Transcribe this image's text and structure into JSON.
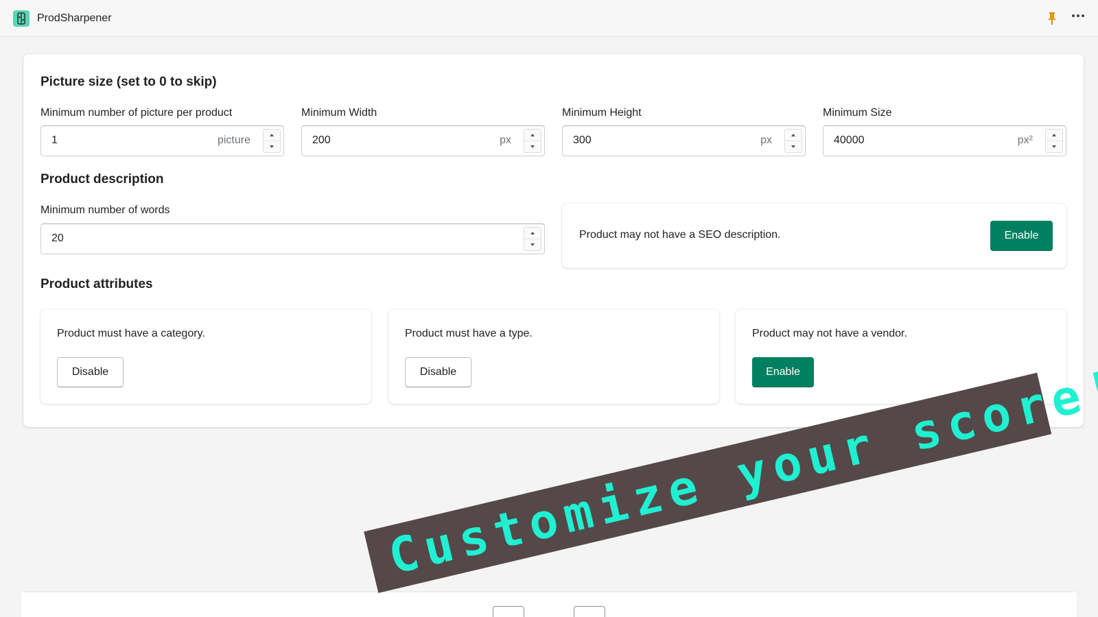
{
  "app": {
    "title": "ProdSharpener",
    "logo_icon": "app-logo-icon",
    "accent": "#008060"
  },
  "picture_size": {
    "heading": "Picture size (set to 0 to skip)",
    "fields": [
      {
        "label": "Minimum number of picture per product",
        "value": "1",
        "suffix": "picture"
      },
      {
        "label": "Minimum Width",
        "value": "200",
        "suffix": "px"
      },
      {
        "label": "Minimum Height",
        "value": "300",
        "suffix": "px"
      },
      {
        "label": "Minimum Size",
        "value": "40000",
        "suffix": "px²"
      }
    ]
  },
  "description": {
    "heading": "Product description",
    "words_label": "Minimum number of words",
    "words_value": "20",
    "seo_message": "Product may not have a SEO description.",
    "seo_button": "Enable"
  },
  "attributes": {
    "heading": "Product attributes",
    "cards": [
      {
        "message": "Product must have a category.",
        "button": "Disable"
      },
      {
        "message": "Product must have a type.",
        "button": "Disable"
      },
      {
        "message": "Product may not have a vendor.",
        "button": "Enable"
      }
    ]
  },
  "banner": {
    "text": "Customize your score!",
    "background": "#554848",
    "color": "#20f0d2"
  }
}
